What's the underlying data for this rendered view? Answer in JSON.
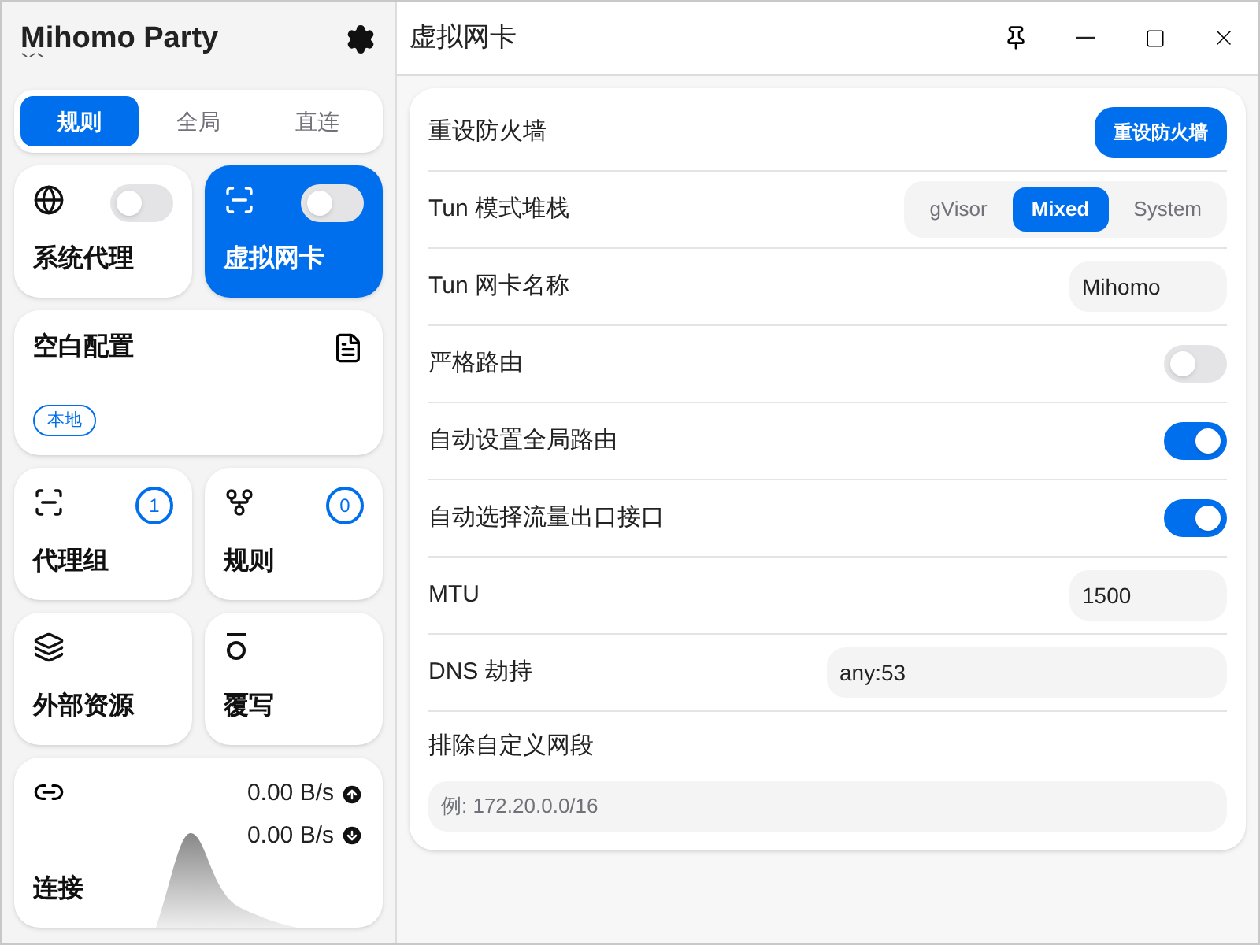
{
  "app": {
    "title": "Mihomo Party"
  },
  "mode_tabs": [
    {
      "label": "规则",
      "selected": true
    },
    {
      "label": "全局",
      "selected": false
    },
    {
      "label": "直连",
      "selected": false
    }
  ],
  "toggle_cards": [
    {
      "kind": "globe",
      "label": "系统代理",
      "selected": false,
      "on": false
    },
    {
      "kind": "tun",
      "label": "虚拟网卡",
      "selected": true,
      "on": false
    }
  ],
  "profile_card": {
    "name": "空白配置",
    "tag": "本地"
  },
  "nav_cards": [
    {
      "kind": "group",
      "label": "代理组",
      "count": "1"
    },
    {
      "kind": "rules",
      "label": "规则",
      "count": "0"
    },
    {
      "kind": "layers",
      "label": "外部资源"
    },
    {
      "kind": "override",
      "label": "覆写"
    }
  ],
  "traffic_card": {
    "label": "连接",
    "upload": "0.00 B/s",
    "download": "0.00 B/s"
  },
  "page": {
    "title": "虚拟网卡"
  },
  "settings": [
    {
      "kind": "button",
      "label": "重设防火墙",
      "button": "重设防火墙"
    },
    {
      "kind": "segmented",
      "label": "Tun 模式堆栈",
      "options": [
        {
          "label": "gVisor",
          "selected": false
        },
        {
          "label": "Mixed",
          "selected": true
        },
        {
          "label": "System",
          "selected": false
        }
      ]
    },
    {
      "kind": "input",
      "label": "Tun 网卡名称",
      "value": "Mihomo"
    },
    {
      "kind": "switch",
      "label": "严格路由",
      "on": false
    },
    {
      "kind": "switch",
      "label": "自动设置全局路由",
      "on": true
    },
    {
      "kind": "switch",
      "label": "自动选择流量出口接口",
      "on": true
    },
    {
      "kind": "input",
      "label": "MTU",
      "value": "1500"
    },
    {
      "kind": "wide-input",
      "label": "DNS 劫持",
      "value": "any:53"
    },
    {
      "kind": "block-input",
      "label": "排除自定义网段",
      "placeholder": "例: 172.20.0.0/16"
    }
  ]
}
